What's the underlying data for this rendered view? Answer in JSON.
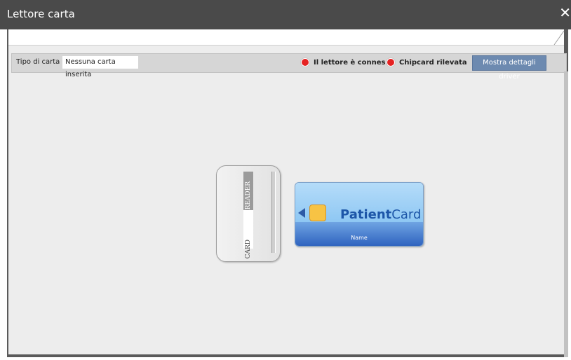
{
  "window": {
    "title": "Lettore carta",
    "close_glyph": "✕"
  },
  "toolbar": {
    "card_type_label": "Tipo di carta",
    "card_type_value": "Nessuna carta inserita",
    "status_reader": "Il lettore è connesso",
    "status_chip": "Chipcard rilevata",
    "driver_button": "Mostra dettagli driver"
  },
  "reader": {
    "label_top": "READER",
    "label_bottom": "CARD"
  },
  "card": {
    "title_bold": "Patient",
    "title_regular": "Card",
    "name_label": "Name"
  },
  "colors": {
    "title_bar": "#4a4a4a",
    "status_dot": "#e52222",
    "driver_button": "#6d8ab0",
    "card_blue": "#1d56a8"
  }
}
